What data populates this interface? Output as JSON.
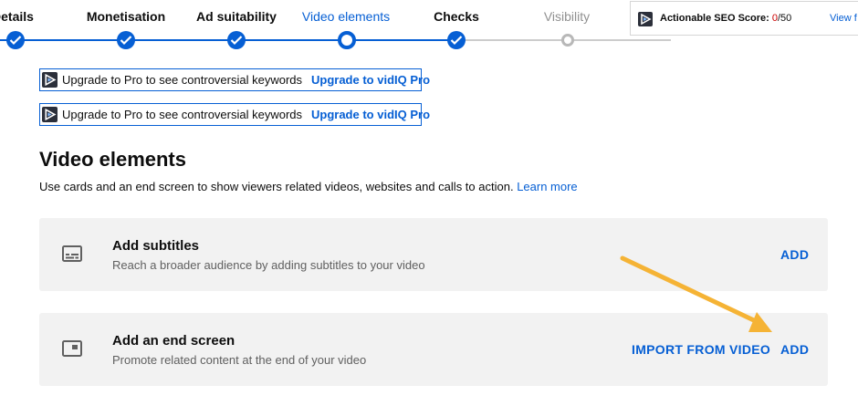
{
  "stepper": {
    "steps": [
      {
        "label": "Details",
        "state": "done"
      },
      {
        "label": "Monetisation",
        "state": "done"
      },
      {
        "label": "Ad suitability",
        "state": "done"
      },
      {
        "label": "Video elements",
        "state": "current"
      },
      {
        "label": "Checks",
        "state": "done"
      },
      {
        "label": "Visibility",
        "state": "future"
      }
    ]
  },
  "seo": {
    "label": "Actionable SEO Score:",
    "score": "0",
    "total": "/50",
    "view": "View f"
  },
  "banners": [
    {
      "text": "Upgrade to Pro to see controversial keywords",
      "link": "Upgrade to vidIQ Pro"
    },
    {
      "text": "Upgrade to Pro to see controversial keywords",
      "link": "Upgrade to vidIQ Pro"
    }
  ],
  "main": {
    "title": "Video elements",
    "description": "Use cards and an end screen to show viewers related videos, websites and calls to action.",
    "learn_more": "Learn more"
  },
  "cards": [
    {
      "title": "Add subtitles",
      "subtitle": "Reach a broader audience by adding subtitles to your video",
      "icon": "subtitles-icon",
      "add_label": "ADD"
    },
    {
      "title": "Add an end screen",
      "subtitle": "Promote related content at the end of your video",
      "icon": "end-screen-icon",
      "import_label": "IMPORT FROM VIDEO",
      "add_label": "ADD"
    }
  ],
  "colors": {
    "accent": "#065fd4",
    "annotation_arrow": "#f5b335"
  }
}
